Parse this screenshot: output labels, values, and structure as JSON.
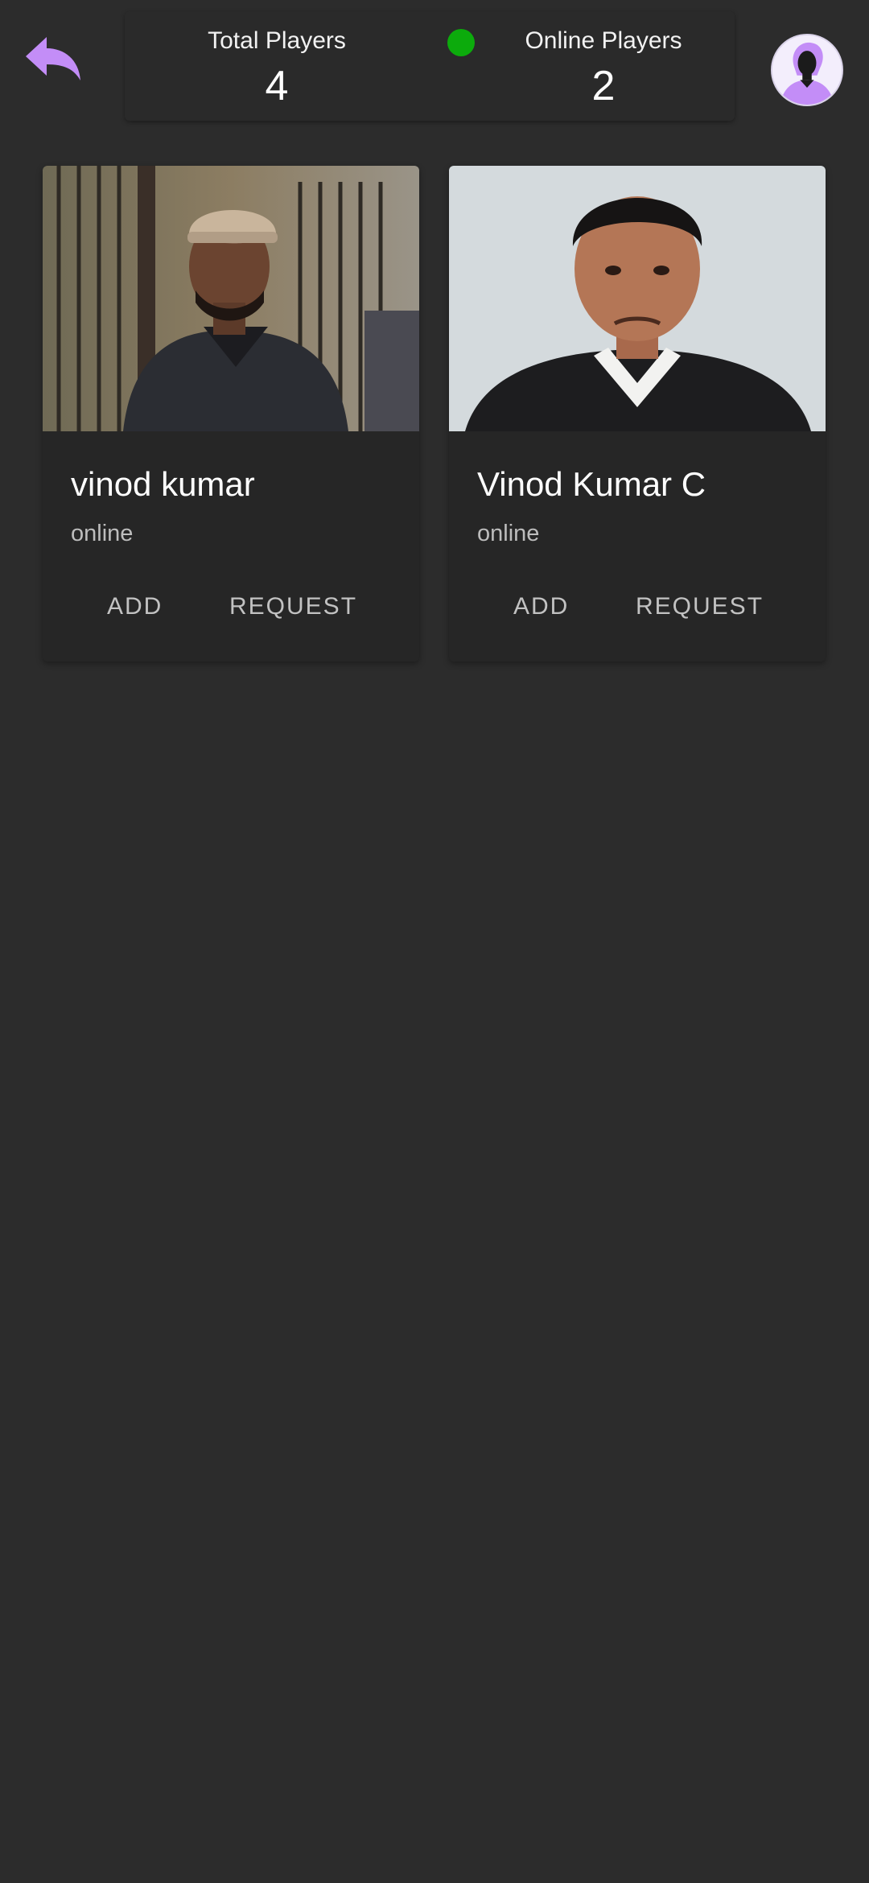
{
  "header": {
    "back_icon": "back-arrow-icon",
    "total_players": {
      "label": "Total Players",
      "value": "4"
    },
    "online_players": {
      "label": "Online Players",
      "value": "2"
    },
    "online_indicator_color": "#0cab0c",
    "profile_icon": "user-avatar-icon",
    "accent_color": "#c38df7"
  },
  "players": [
    {
      "name": "vinod kumar",
      "status": "online",
      "add_label": "ADD",
      "request_label": "REQUEST"
    },
    {
      "name": "Vinod Kumar C",
      "status": "online",
      "add_label": "ADD",
      "request_label": "REQUEST"
    }
  ]
}
